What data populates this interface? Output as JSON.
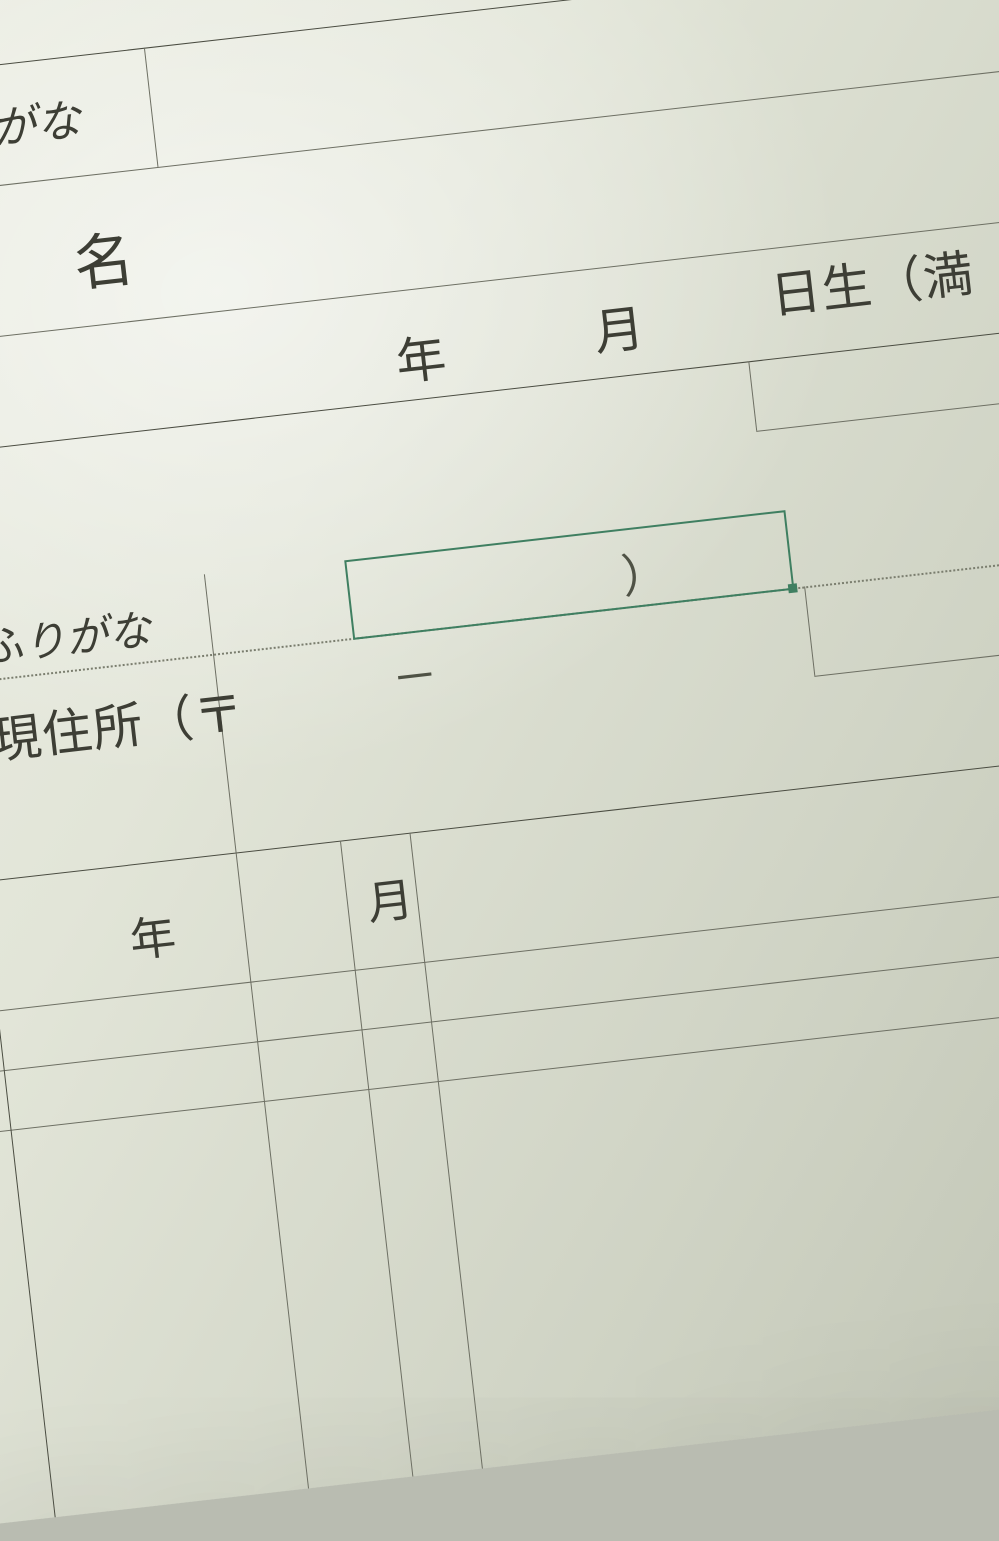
{
  "labels": {
    "furigana_top": "ふりがな",
    "name": "氏　名",
    "year": "年",
    "month": "月",
    "birth_day_suffix": "日生（満",
    "furigana_addr": "ふりがな",
    "address": "現住所（〒",
    "dash": "－",
    "close_paren": "）",
    "year2": "年",
    "month2": "月"
  },
  "selection": {
    "active": true
  }
}
